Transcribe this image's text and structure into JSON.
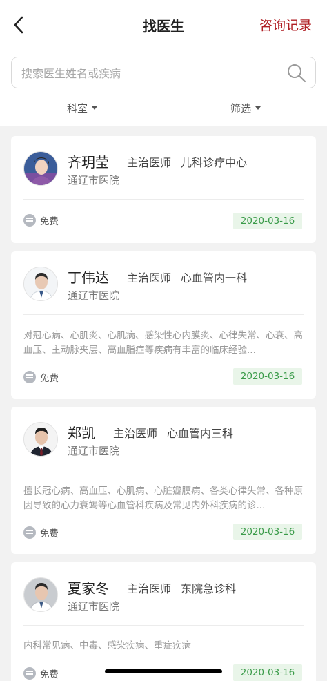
{
  "header": {
    "title": "找医生",
    "records_label": "咨询记录"
  },
  "search": {
    "placeholder": "搜索医生姓名或疾病"
  },
  "filters": {
    "department": "科室",
    "filter": "筛选"
  },
  "doctors": [
    {
      "name": "齐玥莹",
      "title": "主治医师",
      "dept": "儿科诊疗中心",
      "hospital": "通辽市医院",
      "desc": "",
      "free": "免费",
      "date": "2020-03-16"
    },
    {
      "name": "丁伟达",
      "title": "主治医师",
      "dept": "心血管内一科",
      "hospital": "通辽市医院",
      "desc": "对冠心病、心肌炎、心肌病、感染性心内膜炎、心律失常、心衰、高血压、主动脉夹层、高血脂症等疾病有丰富的临床经验...",
      "free": "免费",
      "date": "2020-03-16"
    },
    {
      "name": "郑凯",
      "title": "主治医师",
      "dept": "心血管内三科",
      "hospital": "通辽市医院",
      "desc": "擅长冠心病、高血压、心肌病、心脏瓣膜病、各类心律失常、各种原因导致的心力衰竭等心血管科疾病及常见内外科疾病的诊...",
      "free": "免费",
      "date": "2020-03-16"
    },
    {
      "name": "夏家冬",
      "title": "主治医师",
      "dept": "东院急诊科",
      "hospital": "通辽市医院",
      "desc": "内科常见病、中毒、感染疾病、重症疾病",
      "free": "免费",
      "date": "2020-03-16"
    }
  ]
}
